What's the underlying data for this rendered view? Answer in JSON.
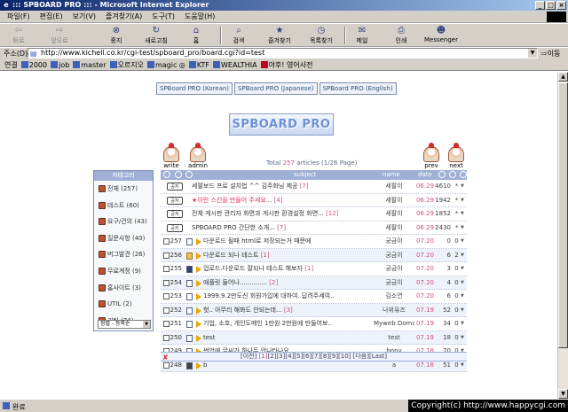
{
  "window": {
    "title": "::: SPBOARD PRO ::: - Microsoft Internet Explorer"
  },
  "menu": [
    "파일(F)",
    "편집(E)",
    "보기(V)",
    "즐겨찾기(A)",
    "도구(T)",
    "도움말(H)"
  ],
  "toolbar": {
    "back": "뒤로",
    "forward": "앞으로",
    "stop": "중지",
    "refresh": "새로고침",
    "home": "홈",
    "search": "검색",
    "favorites": "즐겨찾기",
    "history": "목록찾기",
    "mail": "메일",
    "print": "인쇄",
    "messenger": "Messenger"
  },
  "address": {
    "label": "주소(D)",
    "url": "http://www.kichell.co.kr/cgi-test/spboard_pro/board.cgi?id=test",
    "go": "이동"
  },
  "links": {
    "label": "연결",
    "items": [
      "2000",
      "job",
      "master",
      "오르지오",
      "magic ◎",
      "KTF",
      "WEALTHIA",
      "야후! 영어사전"
    ]
  },
  "board": {
    "tabs": [
      "SPBoard PRO (Korean)",
      "SPBoard PRO (Japanese)",
      "SPBoard PRO (English)"
    ],
    "logo": "SPBOARD PRO",
    "write_label": "write",
    "admin_label": "admin",
    "prev_label": "prev",
    "next_label": "next",
    "total_prefix": "Total",
    "total_count": "257",
    "total_suffix": "articles (1/26 Page)",
    "category": {
      "title": "카테고리",
      "items": [
        "전체 (257)",
        "테스트 (60)",
        "요구/건의 (43)",
        "질문사항 (40)",
        "버그발견 (26)",
        "무료계정 (9)",
        "홈사이트 (3)",
        "UTIL (2)",
        "기타 (74)"
      ],
      "select_value": "정렬 - 등록순"
    },
    "columns": {
      "subject": "subject",
      "name": "name",
      "date": "date"
    },
    "notice_label": "공지",
    "rows": [
      {
        "type": "notice",
        "subject": "세팔보드 프로 설치법 ^^ 김주화님 제공",
        "comments": "[7]",
        "name": "세팔이",
        "date": "06.29",
        "hits": "4610",
        "votes": "*"
      },
      {
        "type": "notice",
        "subject": "★이런 스킨을 만들어 주세요...",
        "comments": "[4]",
        "name": "세팔이",
        "date": "06.29",
        "hits": "1942",
        "votes": "*",
        "hot": true
      },
      {
        "type": "notice",
        "subject": "전체 게시판 관리자 화면과 게시판 환경설정 화면...",
        "comments": "[12]",
        "name": "세팔이",
        "date": "06.29",
        "hits": "1852",
        "votes": "*"
      },
      {
        "type": "notice",
        "subject": "SPBOARD PRO 간단한 소개...",
        "comments": "[7]",
        "name": "세팔이",
        "date": "06.29",
        "hits": "2430",
        "votes": "*"
      },
      {
        "type": "post",
        "num": "257",
        "icon": "doc",
        "subject": "다운로드 될때 html로 저장되는거 때문에",
        "comments": "",
        "name": "궁금이",
        "date": "07.20",
        "hits": "0",
        "votes": "0"
      },
      {
        "type": "post",
        "num": "256",
        "icon": "folder",
        "subject": "다운로드 되나 테스트",
        "comments": "[1]",
        "name": "궁금이",
        "date": "07.20",
        "hits": "6",
        "votes": "2"
      },
      {
        "type": "post",
        "num": "255",
        "icon": "disk",
        "subject": "업로드.다운로드 잘되나 테스트 해보자",
        "comments": "[1]",
        "name": "궁금이",
        "date": "07.20",
        "hits": "3",
        "votes": "0"
      },
      {
        "type": "post",
        "num": "254",
        "icon": "doc",
        "subject": "애플릿 들어나..............",
        "comments": "[2]",
        "name": "궁금이",
        "date": "07.20",
        "hits": "4",
        "votes": "0"
      },
      {
        "type": "post",
        "num": "253",
        "icon": "doc",
        "subject": "1999.9.2만도신 회원가입에 대하여..답려주세여..",
        "comments": "",
        "name": "김소연",
        "date": "07.20",
        "hits": "6",
        "votes": "0"
      },
      {
        "type": "post",
        "num": "252",
        "icon": "doc",
        "subject": "헛.. 아무리 해봐도 안되는데... ",
        "comments": "[3]",
        "name": "나위유즈",
        "date": "07.19",
        "hits": "52",
        "votes": "0"
      },
      {
        "type": "post",
        "num": "251",
        "icon": "doc",
        "subject": "기업, 소호, 개인도메인 1만원 2만원에 만들어보..",
        "comments": "",
        "name": "Myweb Doma..",
        "date": "07.19",
        "hits": "34",
        "votes": "0"
      },
      {
        "type": "post",
        "num": "250",
        "icon": "doc",
        "subject": "test",
        "comments": "",
        "name": "test",
        "date": "07.19",
        "hits": "18",
        "votes": "0"
      },
      {
        "type": "post",
        "num": "249",
        "icon": "doc",
        "subject": "썬업에 글씨가 하나두 안나타나요",
        "comments": "",
        "name": "bony",
        "date": "07.18",
        "hits": "70",
        "votes": "0"
      },
      {
        "type": "post",
        "num": "248",
        "icon": "movie",
        "subject": "b",
        "comments": "",
        "name": "a",
        "date": "07.18",
        "hits": "51",
        "votes": "0"
      }
    ],
    "pager": {
      "prev": "[이전]",
      "pages": [
        "1",
        "2",
        "3",
        "4",
        "5",
        "6",
        "7",
        "8",
        "9",
        "10"
      ],
      "next": "[다음]",
      "last": "[Last]"
    }
  },
  "status": {
    "text": "완료",
    "copyright": "Copyright(c) http://www.happycgi.com"
  }
}
